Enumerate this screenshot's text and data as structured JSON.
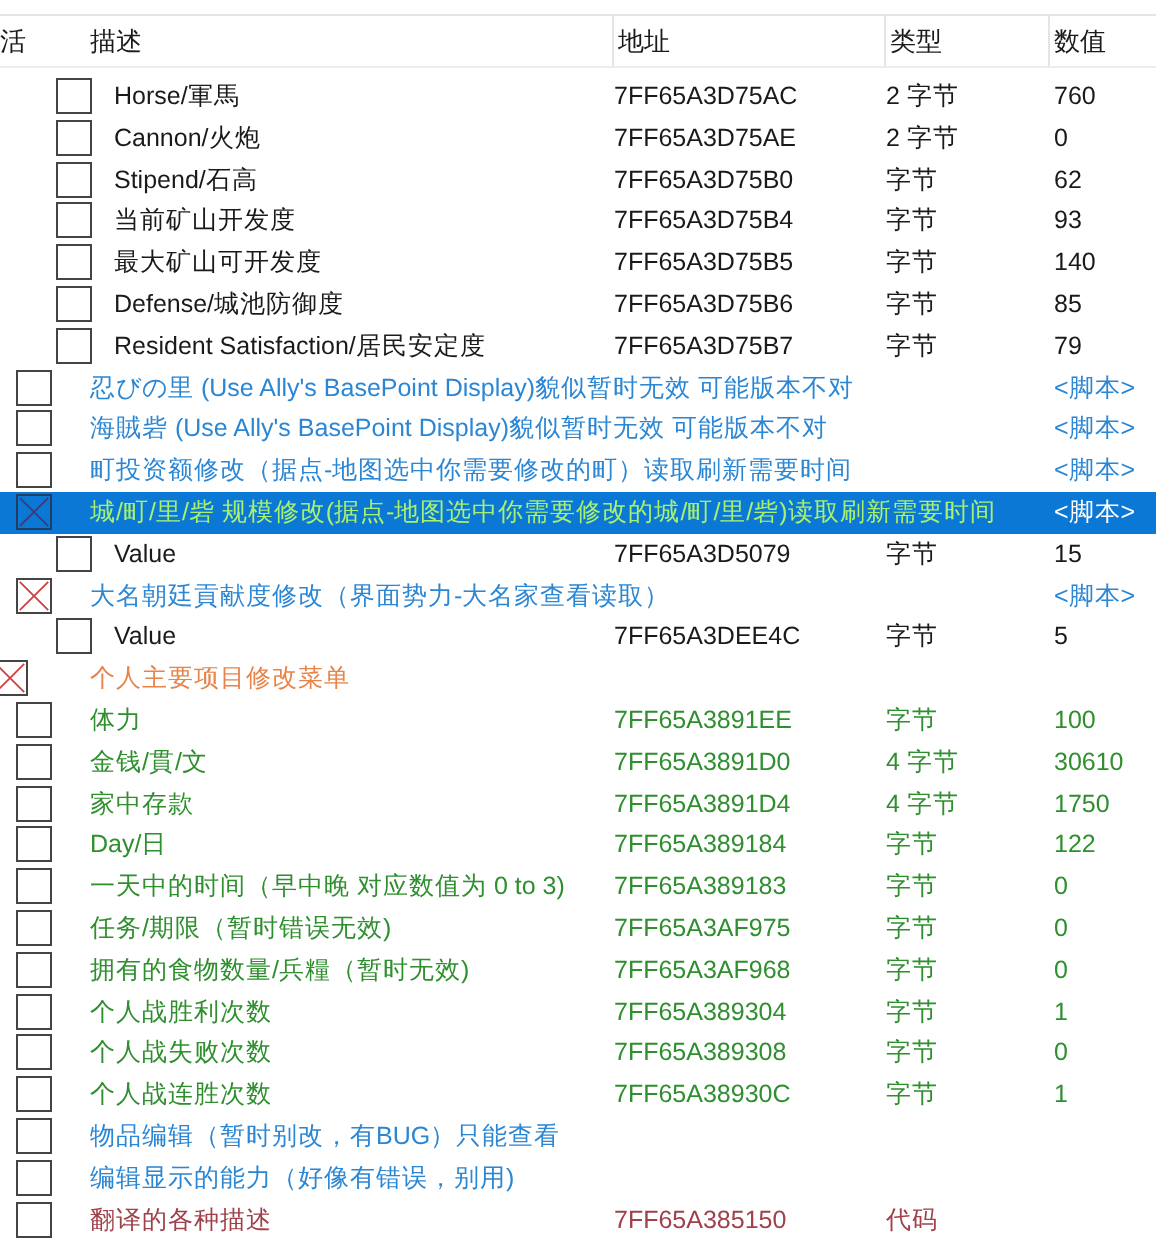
{
  "table": {
    "columns": [
      "活",
      "描述",
      "地址",
      "类型",
      "数值"
    ],
    "entries": [
      {
        "children": [
          {
            "children": [
              {
                "description": "Horse/軍馬",
                "address": "7FF65A3D75AC",
                "type": "2 字节",
                "value": "760",
                "active": false,
                "selected": false,
                "color": "#1a1a1a"
              },
              {
                "description": "Cannon/火炮",
                "address": "7FF65A3D75AE",
                "type": "2 字节",
                "value": "0",
                "active": false,
                "selected": false,
                "color": "#1a1a1a"
              },
              {
                "description": "Stipend/石高",
                "address": "7FF65A3D75B0",
                "type": "字节",
                "value": "62",
                "active": false,
                "selected": false,
                "color": "#1a1a1a"
              },
              {
                "description": "当前矿山开发度",
                "address": "7FF65A3D75B4",
                "type": "字节",
                "value": "93",
                "active": false,
                "selected": false,
                "color": "#1a1a1a"
              },
              {
                "description": "最大矿山可开发度",
                "address": "7FF65A3D75B5",
                "type": "字节",
                "value": "140",
                "active": false,
                "selected": false,
                "color": "#1a1a1a"
              },
              {
                "description": "Defense/城池防御度",
                "address": "7FF65A3D75B6",
                "type": "字节",
                "value": "85",
                "active": false,
                "selected": false,
                "color": "#1a1a1a"
              },
              {
                "description": "Resident Satisfaction/居民安定度",
                "address": "7FF65A3D75B7",
                "type": "字节",
                "value": "79",
                "active": false,
                "selected": false,
                "color": "#1a1a1a"
              }
            ]
          },
          {
            "description": "忍びの里 (Use Ally's BasePoint Display)貌似暂时无效 可能版本不对",
            "value": "<脚本>",
            "active": false,
            "selected": false,
            "color": "#2b86d4"
          },
          {
            "description": "海賊砦 (Use Ally's BasePoint Display)貌似暂时无效 可能版本不对",
            "value": "<脚本>",
            "active": false,
            "selected": false,
            "color": "#2b86d4"
          },
          {
            "description": "町投资额修改（据点-地图选中你需要修改的町）读取刷新需要时间",
            "value": "<脚本>",
            "active": false,
            "selected": false,
            "color": "#2b86d4"
          },
          {
            "description": "城/町/里/砦 规模修改(据点-地图选中你需要修改的城/町/里/砦)读取刷新需要时间",
            "value": "<脚本>",
            "active": true,
            "selected": true,
            "color": "#a8f070",
            "children": [
              {
                "description": "Value",
                "address": "7FF65A3D5079",
                "type": "字节",
                "value": "15",
                "active": false,
                "selected": false,
                "color": "#1a1a1a"
              }
            ]
          },
          {
            "description": "大名朝廷貢献度修改（界面势力-大名家查看读取）",
            "value": "<脚本>",
            "active": true,
            "selected": false,
            "color": "#2b86d4",
            "children": [
              {
                "description": "Value",
                "address": "7FF65A3DEE4C",
                "type": "字节",
                "value": "5",
                "active": false,
                "selected": false,
                "color": "#1a1a1a"
              }
            ]
          }
        ]
      },
      {
        "description": "个人主要项目修改菜单",
        "active": true,
        "selected": false,
        "color": "#e8844a",
        "children": [
          {
            "description": "体力",
            "address": "7FF65A3891EE",
            "type": "字节",
            "value": "100",
            "active": false,
            "selected": false,
            "color": "#2f8f2f"
          },
          {
            "description": "金钱/貫/文",
            "address": "7FF65A3891D0",
            "type": "4 字节",
            "value": "30610",
            "active": false,
            "selected": false,
            "color": "#2f8f2f"
          },
          {
            "description": "家中存款",
            "address": "7FF65A3891D4",
            "type": "4 字节",
            "value": "1750",
            "active": false,
            "selected": false,
            "color": "#2f8f2f"
          },
          {
            "description": "Day/日",
            "address": "7FF65A389184",
            "type": "字节",
            "value": "122",
            "active": false,
            "selected": false,
            "color": "#2f8f2f"
          },
          {
            "description": "一天中的时间（早中晚 对应数值为 0 to 3)",
            "address": "7FF65A389183",
            "type": "字节",
            "value": "0",
            "active": false,
            "selected": false,
            "color": "#2f8f2f"
          },
          {
            "description": "任务/期限（暂时错误无效)",
            "address": "7FF65A3AF975",
            "type": "字节",
            "value": "0",
            "active": false,
            "selected": false,
            "color": "#2f8f2f"
          },
          {
            "description": "拥有的食物数量/兵糧（暂时无效)",
            "address": "7FF65A3AF968",
            "type": "字节",
            "value": "0",
            "active": false,
            "selected": false,
            "color": "#2f8f2f"
          },
          {
            "description": "个人战胜利次数",
            "address": "7FF65A389304",
            "type": "字节",
            "value": "1",
            "active": false,
            "selected": false,
            "color": "#2f8f2f"
          },
          {
            "description": "个人战失败次数",
            "address": "7FF65A389308",
            "type": "字节",
            "value": "0",
            "active": false,
            "selected": false,
            "color": "#2f8f2f"
          },
          {
            "description": "个人战连胜次数",
            "address": "7FF65A38930C",
            "type": "字节",
            "value": "1",
            "active": false,
            "selected": false,
            "color": "#2f8f2f"
          },
          {
            "description": "物品编辑（暂时别改，有BUG）只能查看",
            "active": false,
            "selected": false,
            "color": "#2b86d4"
          },
          {
            "description": "编辑显示的能力（好像有错误，别用)",
            "active": false,
            "selected": false,
            "color": "#2b86d4"
          },
          {
            "description": "翻译的各种描述",
            "address": "7FF65A385150",
            "type": "代码",
            "active": false,
            "selected": false,
            "color": "#a0404a"
          }
        ]
      }
    ]
  }
}
